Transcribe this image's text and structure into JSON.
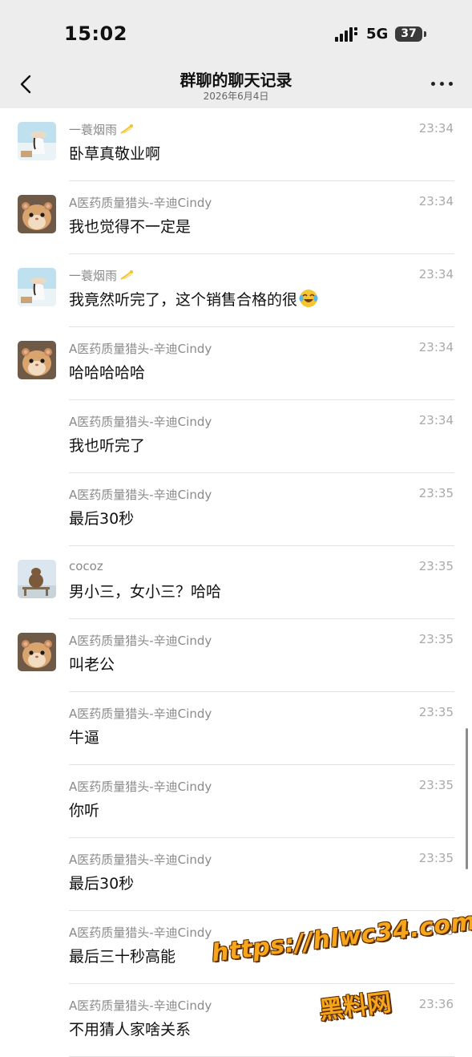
{
  "status_bar": {
    "time": "15:02",
    "network": "5G",
    "battery": "37"
  },
  "nav": {
    "title": "群聊的聊天记录",
    "subtitle": "2026年6月4日"
  },
  "messages": [
    {
      "sender": "一蓑烟雨",
      "time": "23:34",
      "text": "卧草真敬业啊",
      "avatar": "beach-girl",
      "sparkle": true
    },
    {
      "sender": "A医药质量猎头-辛迪Cindy",
      "time": "23:34",
      "text": "我也觉得不一定是",
      "avatar": "hamster"
    },
    {
      "sender": "一蓑烟雨",
      "time": "23:34",
      "text": "我竟然听完了，这个销售合格的很",
      "avatar": "beach-girl",
      "sparkle": true,
      "emoji": "laughing-crying-emoji"
    },
    {
      "sender": "A医药质量猎头-辛迪Cindy",
      "time": "23:34",
      "text": "哈哈哈哈哈",
      "avatar": "hamster"
    },
    {
      "sender": "A医药质量猎头-辛迪Cindy",
      "time": "23:34",
      "text": "我也听完了",
      "avatar": ""
    },
    {
      "sender": "A医药质量猎头-辛迪Cindy",
      "time": "23:35",
      "text": "最后30秒",
      "avatar": ""
    },
    {
      "sender": "cocoz",
      "time": "23:35",
      "text": "男小三，女小三？哈哈",
      "avatar": "capybara"
    },
    {
      "sender": "A医药质量猎头-辛迪Cindy",
      "time": "23:35",
      "text": "叫老公",
      "avatar": "hamster"
    },
    {
      "sender": "A医药质量猎头-辛迪Cindy",
      "time": "23:35",
      "text": "牛逼",
      "avatar": ""
    },
    {
      "sender": "A医药质量猎头-辛迪Cindy",
      "time": "23:35",
      "text": "你听",
      "avatar": ""
    },
    {
      "sender": "A医药质量猎头-辛迪Cindy",
      "time": "23:35",
      "text": "最后30秒",
      "avatar": ""
    },
    {
      "sender": "A医药质量猎头-辛迪Cindy",
      "time": "23:36",
      "text": "最后三十秒高能",
      "avatar": ""
    },
    {
      "sender": "A医药质量猎头-辛迪Cindy",
      "time": "23:36",
      "text": "不用猜人家啥关系",
      "avatar": ""
    }
  ],
  "watermark": {
    "url": "https://hlwc34.com",
    "name": "黑料网"
  },
  "colors": {
    "bar_bg": "#ededed",
    "name_gray": "#8a8a8a",
    "watermark": "#f7a51a"
  }
}
